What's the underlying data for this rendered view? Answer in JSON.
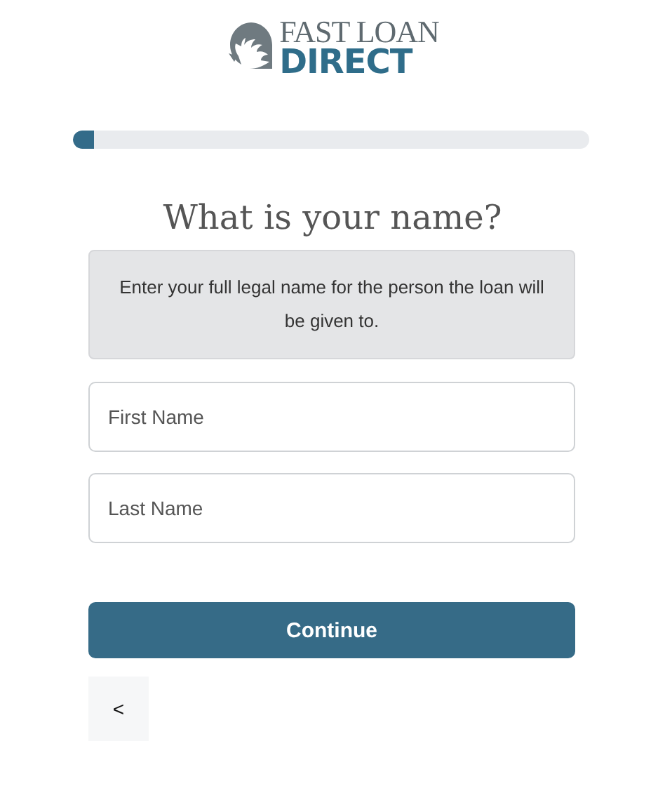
{
  "logo": {
    "line_1": "FAST LOAN",
    "line_2": "DIRECT"
  },
  "progress": {
    "level": 0.04
  },
  "heading": "What is your name?",
  "notice": "Enter your full legal name for the person the loan will be given to.",
  "fields": [
    {
      "placeholder": "First Name"
    },
    {
      "placeholder": "Last Name"
    }
  ],
  "continue_button": "Continue",
  "back_button": "<"
}
